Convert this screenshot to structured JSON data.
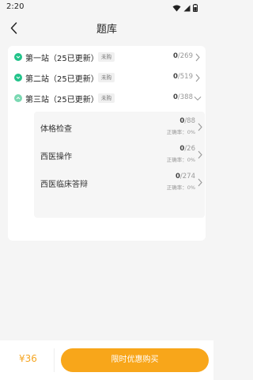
{
  "status_bar": {
    "time": "2:20"
  },
  "header": {
    "title": "题库"
  },
  "stations": [
    {
      "name": "第一站（25已更新）",
      "badge": "未购",
      "done": "0",
      "total": "/269",
      "expanded": false
    },
    {
      "name": "第二站（25已更新）",
      "badge": "未购",
      "done": "0",
      "total": "/519",
      "expanded": false
    },
    {
      "name": "第三站（25已更新）",
      "badge": "未购",
      "done": "0",
      "total": "/388",
      "expanded": true
    }
  ],
  "sub_items": [
    {
      "name": "体格检查",
      "done": "0",
      "total": "/88",
      "rate": "正确率：0%"
    },
    {
      "name": "西医操作",
      "done": "0",
      "total": "/26",
      "rate": "正确率：0%"
    },
    {
      "name": "西医临床答辩",
      "done": "0",
      "total": "/274",
      "rate": "正确率：0%"
    }
  ],
  "footer": {
    "price": "¥36",
    "buy_label": "限时优惠购买"
  },
  "colors": {
    "accent": "#f8a61a",
    "check": "#22c38a",
    "price": "#f5a623"
  }
}
